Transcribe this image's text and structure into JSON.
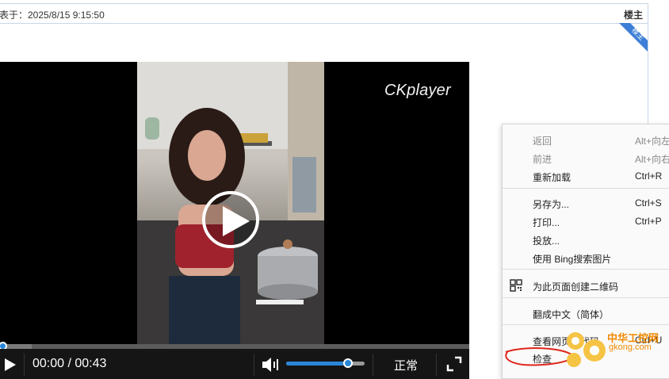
{
  "post": {
    "time_text": "表于：2025/8/15 9:15:50",
    "author_tag": "楼主",
    "ribbon_text": "楼主"
  },
  "player": {
    "watermark": "CKplayer",
    "time_display": "00:00 / 00:43",
    "speed_label": "正常",
    "progress_fraction": 0.005,
    "buffered_fraction": 0.07,
    "volume_fraction": 0.79
  },
  "context_menu": {
    "items": [
      {
        "label": "返回",
        "shortcut": "Alt+向左",
        "disabled": true
      },
      {
        "label": "前进",
        "shortcut": "Alt+向右",
        "disabled": true
      },
      {
        "label": "重新加载",
        "shortcut": "Ctrl+R",
        "disabled": false
      },
      {
        "label": "另存为...",
        "shortcut": "Ctrl+S",
        "disabled": false
      },
      {
        "label": "打印...",
        "shortcut": "Ctrl+P",
        "disabled": false
      },
      {
        "label": "投放...",
        "shortcut": "",
        "disabled": false
      },
      {
        "label": "使用 Bing搜索图片",
        "shortcut": "",
        "disabled": false
      },
      {
        "label": "为此页面创建二维码",
        "shortcut": "",
        "disabled": false
      },
      {
        "label": "翻成中文（简体）",
        "shortcut": "",
        "disabled": false
      },
      {
        "label": "查看网页源代码",
        "shortcut": "Ctrl+U",
        "disabled": false
      },
      {
        "label": "检查",
        "shortcut": "",
        "disabled": false
      }
    ]
  },
  "watermark_logo": {
    "title": "中华工控网",
    "url": "gkong.com"
  },
  "colors": {
    "accent_blue": "#2a87d8",
    "ribbon_blue": "#3d7fd6",
    "annotation_red": "#e0261b",
    "logo_orange": "#f08a00"
  }
}
